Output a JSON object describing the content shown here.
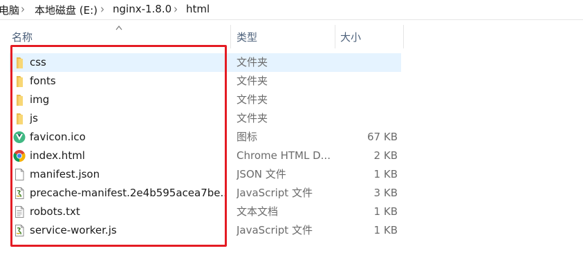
{
  "breadcrumb": {
    "items": [
      "电脑",
      "本地磁盘 (E:)",
      "nginx-1.8.0",
      "html"
    ]
  },
  "columns": {
    "name": "名称",
    "type": "类型",
    "size": "大小"
  },
  "files": [
    {
      "name": "css",
      "type": "文件夹",
      "size": "",
      "icon": "folder-icon",
      "selected": true
    },
    {
      "name": "fonts",
      "type": "文件夹",
      "size": "",
      "icon": "folder-icon"
    },
    {
      "name": "img",
      "type": "文件夹",
      "size": "",
      "icon": "folder-icon"
    },
    {
      "name": "js",
      "type": "文件夹",
      "size": "",
      "icon": "folder-icon"
    },
    {
      "name": "favicon.ico",
      "type": "图标",
      "size": "67 KB",
      "icon": "vue-logo-icon"
    },
    {
      "name": "index.html",
      "type": "Chrome HTML D...",
      "size": "2 KB",
      "icon": "chrome-icon"
    },
    {
      "name": "manifest.json",
      "type": "JSON 文件",
      "size": "1 KB",
      "icon": "blank-file-icon"
    },
    {
      "name": "precache-manifest.2e4b595acea7be...",
      "type": "JavaScript 文件",
      "size": "3 KB",
      "icon": "script-file-icon"
    },
    {
      "name": "robots.txt",
      "type": "文本文档",
      "size": "1 KB",
      "icon": "text-file-icon"
    },
    {
      "name": "service-worker.js",
      "type": "JavaScript 文件",
      "size": "1 KB",
      "icon": "script-file-icon"
    }
  ],
  "colors": {
    "selection": "#e5f3ff",
    "highlight_border": "#e41b23",
    "header_text": "#4c607a",
    "folder": "#f8d775"
  }
}
